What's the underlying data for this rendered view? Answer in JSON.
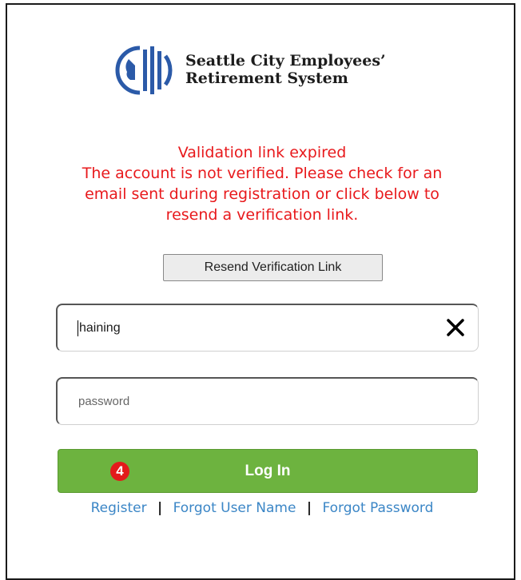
{
  "header": {
    "org_name_line1": "Seattle City Employees’",
    "org_name_line2": "Retirement System",
    "logo_icon": "seattle-city-logo-icon"
  },
  "alert": {
    "title": "Validation link expired",
    "lines": [
      "The account is not verified. Please check for an",
      "email sent during registration or click below to",
      "resend a verification link."
    ],
    "color": "#e8191c"
  },
  "resend_button": {
    "label": "Resend Verification Link"
  },
  "username": {
    "value": "haining",
    "clear_icon": "close-icon"
  },
  "password": {
    "placeholder": "password"
  },
  "login_button": {
    "label": "Log In",
    "color": "#6db33f"
  },
  "step_badge": {
    "label": "4"
  },
  "links": {
    "register": "Register",
    "separator": "|",
    "forgot_username": "Forgot User Name",
    "forgot_password": "Forgot Password",
    "color": "#3b86c6"
  }
}
